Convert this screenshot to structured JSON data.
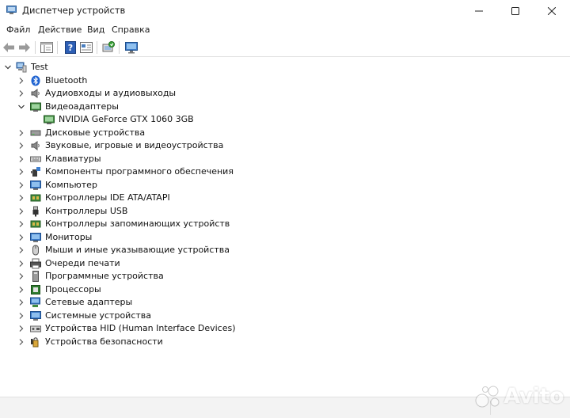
{
  "window": {
    "title": "Диспетчер устройств",
    "minimize_icon": "minimize-icon",
    "maximize_icon": "maximize-icon",
    "close_icon": "close-icon"
  },
  "menu": [
    "Файл",
    "Действие",
    "Вид",
    "Справка"
  ],
  "toolbar": {
    "buttons": [
      "back-arrow-icon",
      "forward-arrow-icon",
      "properties-icon",
      "help-icon",
      "update-driver-icon",
      "scan-hardware-icon",
      "monitor-icon"
    ]
  },
  "tree": {
    "root": "Test",
    "items": [
      {
        "label": "Bluetooth",
        "icon": "bluetooth-icon",
        "expanded": false
      },
      {
        "label": "Аудиовходы и аудиовыходы",
        "icon": "speaker-icon",
        "expanded": false
      },
      {
        "label": "Видеоадаптеры",
        "icon": "display-adapter-icon",
        "expanded": true,
        "children": [
          {
            "label": "NVIDIA GeForce GTX 1060 3GB",
            "icon": "gpu-icon"
          }
        ]
      },
      {
        "label": "Дисковые устройства",
        "icon": "disk-icon",
        "expanded": false
      },
      {
        "label": "Звуковые, игровые и видеоустройства",
        "icon": "sound-icon",
        "expanded": false
      },
      {
        "label": "Клавиатуры",
        "icon": "keyboard-icon",
        "expanded": false
      },
      {
        "label": "Компоненты программного обеспечения",
        "icon": "software-component-icon",
        "expanded": false
      },
      {
        "label": "Компьютер",
        "icon": "computer-icon",
        "expanded": false
      },
      {
        "label": "Контроллеры IDE ATA/ATAPI",
        "icon": "ide-controller-icon",
        "expanded": false
      },
      {
        "label": "Контроллеры USB",
        "icon": "usb-icon",
        "expanded": false
      },
      {
        "label": "Контроллеры запоминающих устройств",
        "icon": "storage-controller-icon",
        "expanded": false
      },
      {
        "label": "Мониторы",
        "icon": "monitor-icon",
        "expanded": false
      },
      {
        "label": "Мыши и иные указывающие устройства",
        "icon": "mouse-icon",
        "expanded": false
      },
      {
        "label": "Очереди печати",
        "icon": "printer-icon",
        "expanded": false
      },
      {
        "label": "Программные устройства",
        "icon": "software-device-icon",
        "expanded": false
      },
      {
        "label": "Процессоры",
        "icon": "processor-icon",
        "expanded": false
      },
      {
        "label": "Сетевые адаптеры",
        "icon": "network-adapter-icon",
        "expanded": false
      },
      {
        "label": "Системные устройства",
        "icon": "system-device-icon",
        "expanded": false
      },
      {
        "label": "Устройства HID (Human Interface Devices)",
        "icon": "hid-icon",
        "expanded": false
      },
      {
        "label": "Устройства безопасности",
        "icon": "security-device-icon",
        "expanded": false
      }
    ]
  },
  "watermark": "Avito"
}
